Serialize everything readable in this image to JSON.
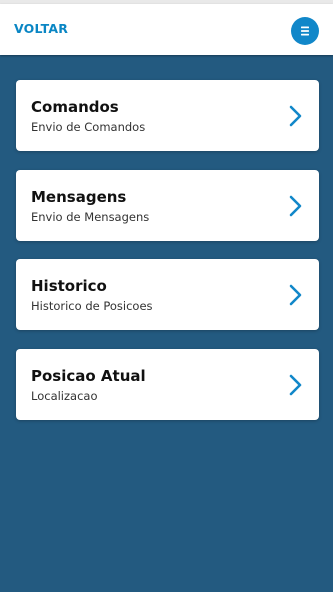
{
  "header": {
    "back_label": "VOLTAR",
    "menu_icon": "menu-icon"
  },
  "colors": {
    "background": "#235a80",
    "accent": "#1187c9",
    "back_text": "#0a86c4",
    "card": "#ffffff"
  },
  "menu_items": [
    {
      "title": "Comandos",
      "subtitle": "Envio de Comandos"
    },
    {
      "title": "Mensagens",
      "subtitle": "Envio de Mensagens"
    },
    {
      "title": "Historico",
      "subtitle": "Historico de Posicoes"
    },
    {
      "title": "Posicao Atual",
      "subtitle": "Localizacao"
    }
  ]
}
